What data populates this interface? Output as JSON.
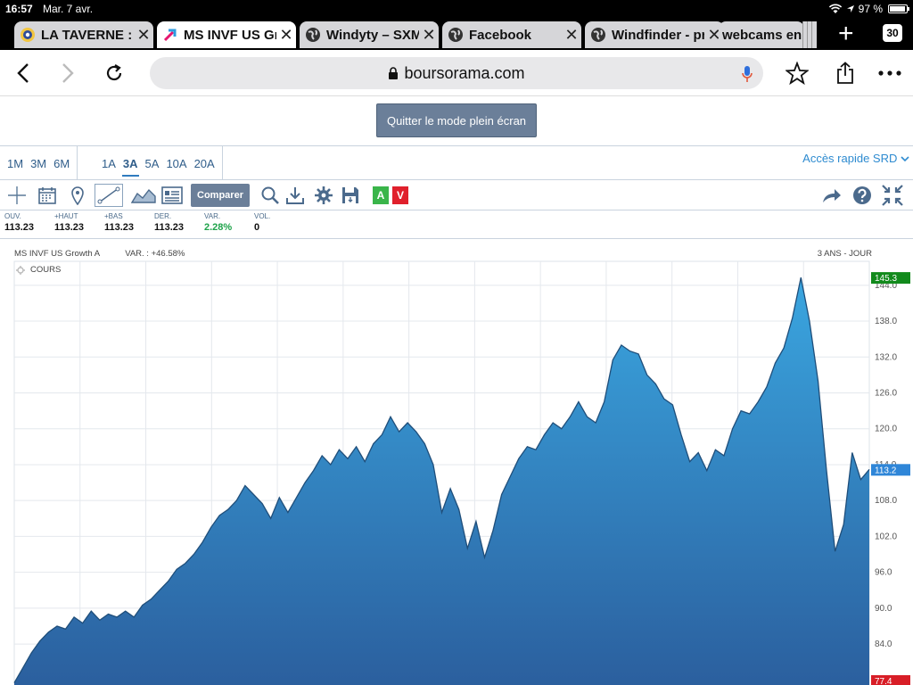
{
  "status_bar": {
    "time": "16:57",
    "date": "Mar. 7 avr.",
    "battery": "97 %"
  },
  "tabs": [
    {
      "title": "LA TAVERNE : Fo",
      "active": false
    },
    {
      "title": "MS INVF US Gro",
      "active": true
    },
    {
      "title": "Windyty – SXM-",
      "active": false
    },
    {
      "title": "Facebook",
      "active": false
    },
    {
      "title": "Windfinder - prévisions",
      "active": false
    },
    {
      "title": "webcams en",
      "active": false
    }
  ],
  "tab_count": "30",
  "url": "boursorama.com",
  "fullscreen_exit_label": "Quitter le mode plein écran",
  "periods_short": [
    "1M",
    "3M",
    "6M"
  ],
  "periods_long": [
    "1A",
    "3A",
    "5A",
    "10A",
    "20A"
  ],
  "active_period": "3A",
  "quick_access_label": "Accès rapide SRD",
  "compare_label": "Comparer",
  "av": {
    "a": "A",
    "v": "V"
  },
  "quote": {
    "open": {
      "label": "OUV.",
      "value": "113.23"
    },
    "high": {
      "label": "+HAUT",
      "value": "113.23"
    },
    "low": {
      "label": "+BAS",
      "value": "113.23"
    },
    "last": {
      "label": "DER.",
      "value": "113.23"
    },
    "var": {
      "label": "VAR.",
      "value": "2.28%"
    },
    "vol": {
      "label": "VOL.",
      "value": "0"
    }
  },
  "chart_head": {
    "name": "MS INVF US Growth A",
    "var": "VAR. : +46.58%",
    "period": "3 ANS - JOUR",
    "legend": "COURS"
  },
  "colors": {
    "area_top": "#3aa6e0",
    "area_bottom": "#2b5f9e",
    "line": "#1f4e7a",
    "high_tag": "#128a1c",
    "last_tag": "#2f86d8",
    "low_tag": "#d81e27"
  },
  "chart_data": {
    "type": "area",
    "title": "",
    "xlabel": "",
    "ylabel": "",
    "ylim": [
      77,
      148
    ],
    "yticks": [
      78,
      84,
      90,
      96,
      102,
      108,
      114,
      120,
      126,
      132,
      138,
      144
    ],
    "price_tags": {
      "high": "145.3",
      "last": "113.2",
      "low": "77.4"
    },
    "x": [
      0,
      1,
      2,
      3,
      4,
      5,
      6,
      7,
      8,
      9,
      10,
      11,
      12,
      13,
      14,
      15,
      16,
      17,
      18,
      19,
      20,
      21,
      22,
      23,
      24,
      25,
      26,
      27,
      28,
      29,
      30,
      31,
      32,
      33,
      34,
      35,
      36,
      37,
      38,
      39,
      40,
      41,
      42,
      43,
      44,
      45,
      46,
      47,
      48,
      49,
      50,
      51,
      52,
      53,
      54,
      55,
      56,
      57,
      58,
      59,
      60,
      61,
      62,
      63,
      64,
      65,
      66,
      67,
      68,
      69,
      70,
      71,
      72,
      73,
      74,
      75,
      76,
      77,
      78,
      79,
      80,
      81,
      82,
      83,
      84,
      85,
      86,
      87,
      88,
      89,
      90,
      91,
      92,
      93,
      94,
      95,
      96,
      97,
      98,
      99,
      100
    ],
    "values": [
      77.5,
      80.0,
      82.5,
      84.5,
      86.0,
      87.0,
      86.5,
      88.5,
      87.5,
      89.5,
      88.0,
      89.0,
      88.5,
      89.5,
      88.5,
      90.5,
      91.5,
      93.0,
      94.5,
      96.5,
      97.5,
      99.0,
      101.0,
      103.5,
      105.5,
      106.5,
      108.0,
      110.5,
      109.0,
      107.5,
      105.0,
      108.5,
      106.0,
      108.5,
      111.0,
      113.0,
      115.5,
      114.0,
      116.5,
      115.0,
      117.0,
      114.5,
      117.5,
      119.0,
      122.0,
      119.5,
      121.0,
      119.5,
      117.5,
      114.0,
      106.0,
      110.0,
      106.5,
      100.0,
      104.5,
      98.5,
      103.0,
      109.0,
      112.0,
      115.0,
      117.0,
      116.5,
      119.0,
      121.0,
      120.0,
      122.0,
      124.5,
      122.0,
      121.0,
      124.5,
      131.5,
      134.0,
      133.0,
      132.5,
      129.0,
      127.5,
      125.0,
      124.0,
      119.0,
      114.5,
      116.0,
      113.0,
      116.5,
      115.5,
      120.0,
      123.0,
      122.5,
      124.5,
      127.0,
      131.0,
      133.5,
      138.5,
      145.3,
      138.0,
      128.0,
      113.0,
      99.5,
      104.0,
      116.0,
      111.5,
      113.2
    ]
  }
}
